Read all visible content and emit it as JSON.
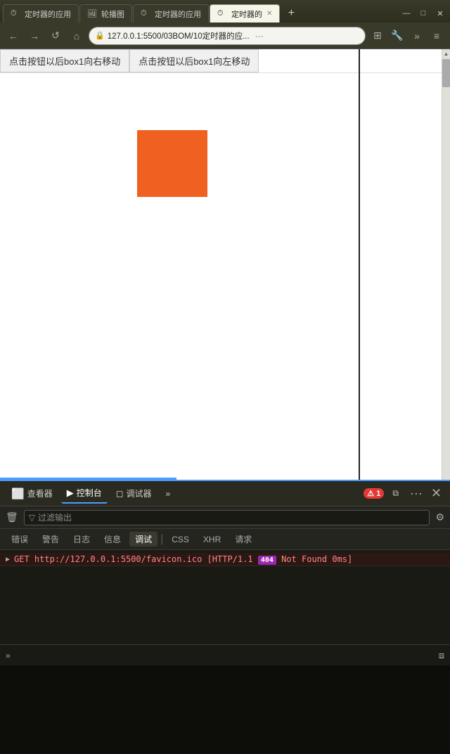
{
  "browser": {
    "tabs": [
      {
        "label": "定时器的应用",
        "active": false,
        "favicon": "⏱"
      },
      {
        "label": "轮播图",
        "active": false,
        "favicon": "🖼"
      },
      {
        "label": "定时器的应用",
        "active": false,
        "favicon": "⏱"
      },
      {
        "label": "定时器的",
        "active": true,
        "favicon": "⏱",
        "close": "✕"
      }
    ],
    "tab_new": "+",
    "window_controls": [
      "—",
      "□",
      "✕"
    ],
    "nav": {
      "back": "←",
      "forward": "→",
      "refresh": "↺",
      "home": "⌂",
      "lock": "🔒",
      "url": "127.0.0.1:5500/03BOM/10定时器的应...",
      "more": "···",
      "extensions": "⊞",
      "settings": "🔧",
      "more_nav": "»",
      "menu": "≡"
    }
  },
  "page": {
    "btn_right": "点击按钮以后box1向右移动",
    "btn_left": "点击按钮以后box1向左移动",
    "box_color": "#f06020"
  },
  "devtools": {
    "tabs": [
      {
        "label": "查看器",
        "icon": "⬜",
        "active": false
      },
      {
        "label": "控制台",
        "icon": "▶",
        "active": true
      },
      {
        "label": "调试器",
        "icon": "◻",
        "active": false
      }
    ],
    "more": "»",
    "error_count": "1",
    "split_icon": "⧉",
    "more_icon": "···",
    "close_icon": "✕",
    "console": {
      "trash_icon": "🗑",
      "filter_placeholder": "过滤输出",
      "filter_icon": "▽",
      "settings_icon": "⚙",
      "log_levels": [
        "错误",
        "警告",
        "日志",
        "信息",
        "调试",
        "CSS",
        "XHR",
        "请求"
      ],
      "active_level": "调试",
      "entry": {
        "arrow": "▶",
        "message": "GET http://127.0.0.1:5500/favicon.ico [HTTP/1.1 ",
        "status": "404",
        "rest": " Not Found 0ms]"
      }
    },
    "input": {
      "chevron": "»"
    }
  }
}
